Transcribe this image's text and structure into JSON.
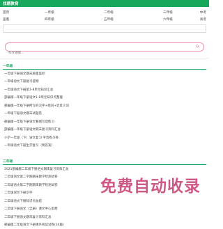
{
  "site": {
    "title": "找题教育"
  },
  "nav": {
    "row1": [
      "首页",
      "一年级",
      "二年级",
      "三年级",
      "中考"
    ],
    "row2": [
      "查看",
      "四年级",
      "五年级",
      "六年级",
      "高考"
    ]
  },
  "search": {
    "placeholder": "作文搜索..."
  },
  "sections": [
    {
      "title": "一年级",
      "items": [
        "一年级下册语文期末质量监控",
        "一年级语文下册复习提纲",
        "一年级语文下册第1-8单元知识汇总",
        "部编版一年级下册语文1-8单元知识点整理",
        "部编版一年级下册所写的汉字+组词+近反义词",
        "一年级下册语文期末试题卷",
        "部编版一年级下册语文看图写话练习",
        "部编版一年级下册语文期末复习资料汇总",
        "小学一年级（下）语文复习 字音练习卷",
        "一年级语文下册生字复习（附答案）"
      ]
    },
    {
      "title": "二年级",
      "items": [
        "2021部编版二年级下册语文期末复习资料汇总",
        "二年级语文第二学期期末教学检测试卷",
        "二年级语文第二学期期末教学检测试卷",
        "二年级语文下册识字",
        "二年级语文下册知识点总结",
        "二年级下册语文（全册）课文中心思想",
        "二年级下册语文期末复习资料汇总",
        "部编版二年级语文下册课外阅读试卷(30篇)"
      ]
    }
  ],
  "watermark": {
    "text": "免费自动收录"
  },
  "colors": {
    "brand": "#16a75c",
    "search_border": "#e88fb2",
    "watermark": "#d0528a"
  }
}
